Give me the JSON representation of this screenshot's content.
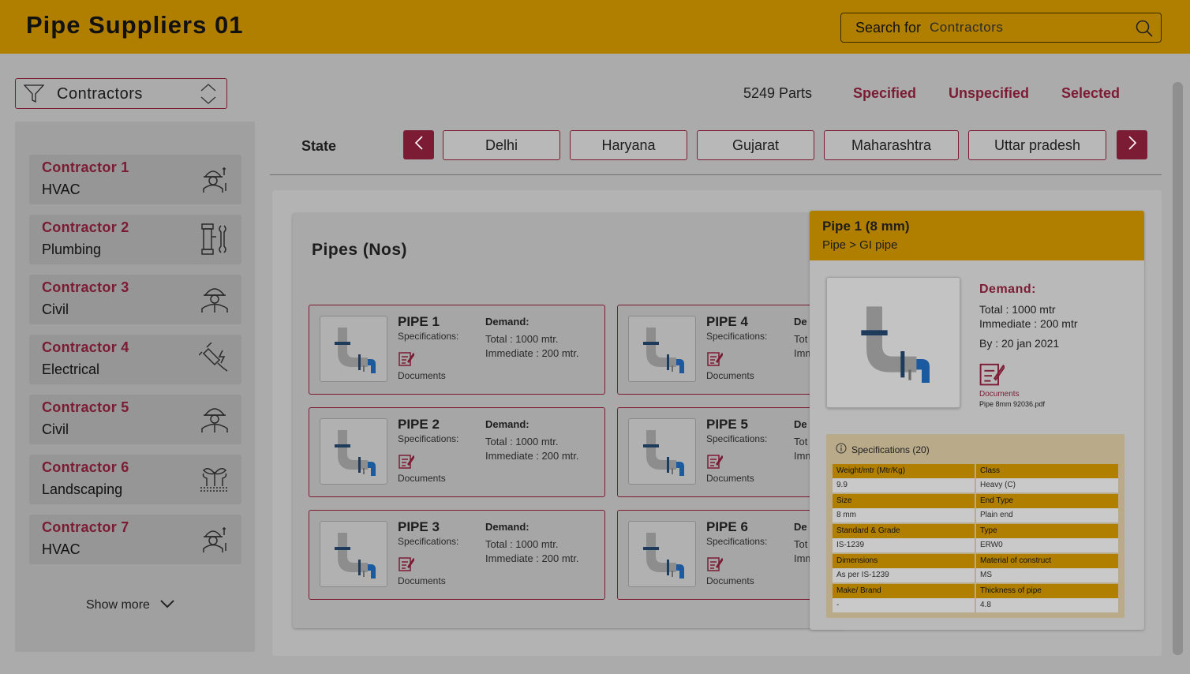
{
  "header": {
    "title": "Pipe Suppliers 01",
    "search_prefix": "Search for",
    "search_placeholder": "Contractors"
  },
  "filter": {
    "label": "Contractors"
  },
  "contractors": [
    {
      "name": "Contractor 1",
      "type": "HVAC",
      "icon": "worker-tools-icon"
    },
    {
      "name": "Contractor 2",
      "type": "Plumbing",
      "icon": "plumbing-icon"
    },
    {
      "name": "Contractor 3",
      "type": "Civil",
      "icon": "hard-hat-worker-icon"
    },
    {
      "name": "Contractor 4",
      "type": "Electrical",
      "icon": "electrical-plug-icon"
    },
    {
      "name": "Contractor 5",
      "type": "Civil",
      "icon": "hard-hat-worker-icon"
    },
    {
      "name": "Contractor 6",
      "type": "Landscaping",
      "icon": "landscaping-icon"
    },
    {
      "name": "Contractor 7",
      "type": "HVAC",
      "icon": "worker-tools-icon"
    }
  ],
  "show_more": "Show more",
  "stats": {
    "parts": "5249 Parts",
    "specified": "Specified",
    "unspecified": "Unspecified",
    "selected": "Selected"
  },
  "states": {
    "label": "State",
    "items": [
      "Delhi",
      "Haryana",
      "Gujarat",
      "Maharashtra",
      "Uttar pradesh"
    ]
  },
  "pipes": {
    "title": "Pipes (Nos)",
    "spec_label": "Specifications:",
    "docs_label": "Documents",
    "demand_label": "Demand:",
    "total": "Total : 1000 mtr.",
    "immediate": "Immediate : 200 mtr.",
    "items": [
      {
        "name": "PIPE 1"
      },
      {
        "name": "PIPE 4",
        "demand": "De",
        "total": "Tot",
        "immediate": "Imm"
      },
      {
        "name": "PIPE 2"
      },
      {
        "name": "PIPE 5",
        "demand": "De",
        "total": "Tot",
        "immediate": "Imm"
      },
      {
        "name": "PIPE 3"
      },
      {
        "name": "PIPE 6",
        "demand": "De",
        "total": "Tot",
        "immediate": "Imm"
      }
    ]
  },
  "detail": {
    "title": "Pipe 1 (8 mm)",
    "breadcrumb": "Pipe > GI pipe",
    "demand_label": "Demand:",
    "total": "Total : 1000 mtr",
    "immediate": "Immediate : 200 mtr",
    "by": "By : 20 jan 2021",
    "docs_label": "Documents",
    "file": "Pipe 8mm 92036.pdf",
    "spec_title": "Specifications (20)",
    "specs": [
      {
        "label": "Weight/mtr (Mtr/Kg)",
        "value": "9.9"
      },
      {
        "label": "Class",
        "value": "Heavy (C)"
      },
      {
        "label": "Size",
        "value": "8 mm"
      },
      {
        "label": "End Type",
        "value": "Plain end"
      },
      {
        "label": "Standard & Grade",
        "value": "IS-1239"
      },
      {
        "label": "Type",
        "value": "ERW0"
      },
      {
        "label": "Dimensions",
        "value": "As per IS-1239"
      },
      {
        "label": "Material of construct",
        "value": "MS"
      },
      {
        "label": "Make/ Brand",
        "value": "-"
      },
      {
        "label": "Thickness of pipe",
        "value": "4.8"
      }
    ]
  },
  "colors": {
    "accent": "#b17f00",
    "brand": "#7b1c34"
  }
}
